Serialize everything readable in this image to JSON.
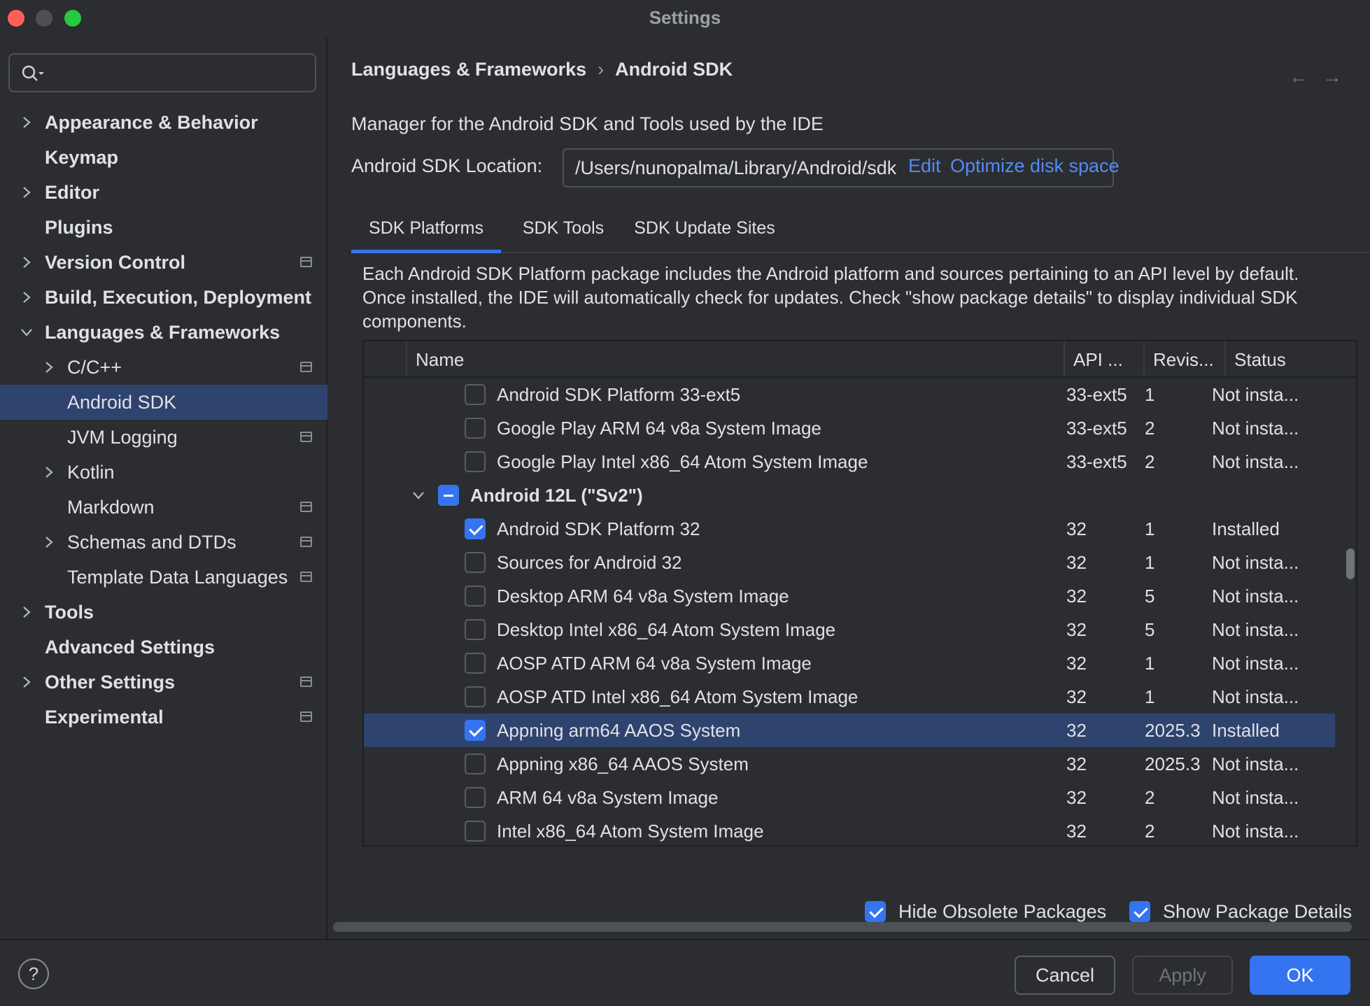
{
  "window": {
    "title": "Settings"
  },
  "sidebar": {
    "search_placeholder": "",
    "items": [
      {
        "label": "Appearance & Behavior",
        "bold": true,
        "level": 0,
        "chevron": "right",
        "project": false
      },
      {
        "label": "Keymap",
        "bold": true,
        "level": 0,
        "chevron": "none",
        "project": false
      },
      {
        "label": "Editor",
        "bold": true,
        "level": 0,
        "chevron": "right",
        "project": false
      },
      {
        "label": "Plugins",
        "bold": true,
        "level": 0,
        "chevron": "none",
        "project": false
      },
      {
        "label": "Version Control",
        "bold": true,
        "level": 0,
        "chevron": "right",
        "project": true
      },
      {
        "label": "Build, Execution, Deployment",
        "bold": true,
        "level": 0,
        "chevron": "right",
        "project": false
      },
      {
        "label": "Languages & Frameworks",
        "bold": true,
        "level": 0,
        "chevron": "down",
        "project": false
      },
      {
        "label": "C/C++",
        "bold": false,
        "level": 1,
        "chevron": "right",
        "project": true
      },
      {
        "label": "Android SDK",
        "bold": false,
        "level": 1,
        "chevron": "none",
        "project": false,
        "selected": true
      },
      {
        "label": "JVM Logging",
        "bold": false,
        "level": 1,
        "chevron": "none",
        "project": true
      },
      {
        "label": "Kotlin",
        "bold": false,
        "level": 1,
        "chevron": "right",
        "project": false
      },
      {
        "label": "Markdown",
        "bold": false,
        "level": 1,
        "chevron": "none",
        "project": true
      },
      {
        "label": "Schemas and DTDs",
        "bold": false,
        "level": 1,
        "chevron": "right",
        "project": true
      },
      {
        "label": "Template Data Languages",
        "bold": false,
        "level": 1,
        "chevron": "none",
        "project": true
      },
      {
        "label": "Tools",
        "bold": true,
        "level": 0,
        "chevron": "right",
        "project": false
      },
      {
        "label": "Advanced Settings",
        "bold": true,
        "level": 0,
        "chevron": "none",
        "project": false
      },
      {
        "label": "Other Settings",
        "bold": true,
        "level": 0,
        "chevron": "right",
        "project": true
      },
      {
        "label": "Experimental",
        "bold": true,
        "level": 0,
        "chevron": "none",
        "project": true
      }
    ]
  },
  "header": {
    "breadcrumb": [
      "Languages & Frameworks",
      "Android SDK"
    ],
    "back_arrow": "←",
    "forward_arrow": "→"
  },
  "main": {
    "description": "Manager for the Android SDK and Tools used by the IDE",
    "location_label": "Android SDK Location:",
    "location_value": "/Users/nunopalma/Library/Android/sdk",
    "edit_link": "Edit",
    "optimize_link": "Optimize disk space",
    "tabs": [
      {
        "label": "SDK Platforms",
        "active": true
      },
      {
        "label": "SDK Tools",
        "active": false
      },
      {
        "label": "SDK Update Sites",
        "active": false
      }
    ],
    "info_text": "Each Android SDK Platform package includes the Android platform and sources pertaining to an API level by default. Once installed, the IDE will automatically check for updates. Check \"show package details\" to display individual SDK components."
  },
  "table": {
    "columns": [
      "Name",
      "API ...",
      "Revis...",
      "Status"
    ],
    "rows": [
      {
        "name": "Android SDK Platform 33-ext5",
        "api": "33-ext5",
        "rev": "1",
        "status": "Not insta...",
        "check": "unchecked",
        "group": false
      },
      {
        "name": "Google Play ARM 64 v8a System Image",
        "api": "33-ext5",
        "rev": "2",
        "status": "Not insta...",
        "check": "unchecked",
        "group": false
      },
      {
        "name": "Google Play Intel x86_64 Atom System Image",
        "api": "33-ext5",
        "rev": "2",
        "status": "Not insta...",
        "check": "unchecked",
        "group": false
      },
      {
        "name": "Android 12L (\"Sv2\")",
        "api": "",
        "rev": "",
        "status": "",
        "check": "partial",
        "group": true
      },
      {
        "name": "Android SDK Platform 32",
        "api": "32",
        "rev": "1",
        "status": "Installed",
        "check": "checked",
        "group": false
      },
      {
        "name": "Sources for Android 32",
        "api": "32",
        "rev": "1",
        "status": "Not insta...",
        "check": "unchecked",
        "group": false
      },
      {
        "name": "Desktop ARM 64 v8a System Image",
        "api": "32",
        "rev": "5",
        "status": "Not insta...",
        "check": "unchecked",
        "group": false
      },
      {
        "name": "Desktop Intel x86_64 Atom System Image",
        "api": "32",
        "rev": "5",
        "status": "Not insta...",
        "check": "unchecked",
        "group": false
      },
      {
        "name": "AOSP ATD ARM 64 v8a System Image",
        "api": "32",
        "rev": "1",
        "status": "Not insta...",
        "check": "unchecked",
        "group": false
      },
      {
        "name": "AOSP ATD Intel x86_64 Atom System Image",
        "api": "32",
        "rev": "1",
        "status": "Not insta...",
        "check": "unchecked",
        "group": false
      },
      {
        "name": "Appning arm64 AAOS System",
        "api": "32",
        "rev": "2025.3",
        "status": "Installed",
        "check": "checked",
        "group": false,
        "selected": true
      },
      {
        "name": "Appning x86_64 AAOS System",
        "api": "32",
        "rev": "2025.3",
        "status": "Not insta...",
        "check": "unchecked",
        "group": false
      },
      {
        "name": "ARM 64 v8a System Image",
        "api": "32",
        "rev": "2",
        "status": "Not insta...",
        "check": "unchecked",
        "group": false
      },
      {
        "name": "Intel x86_64 Atom System Image",
        "api": "32",
        "rev": "2",
        "status": "Not insta...",
        "check": "unchecked",
        "group": false
      }
    ]
  },
  "options": {
    "hide_obsolete": {
      "label": "Hide Obsolete Packages",
      "checked": true
    },
    "show_details": {
      "label": "Show Package Details",
      "checked": true
    }
  },
  "footer": {
    "help": "?",
    "cancel": "Cancel",
    "apply": "Apply",
    "ok": "OK"
  },
  "colors": {
    "accent": "#3574f0",
    "selection": "#2e436e",
    "link": "#548af7",
    "background": "#2b2d30"
  }
}
